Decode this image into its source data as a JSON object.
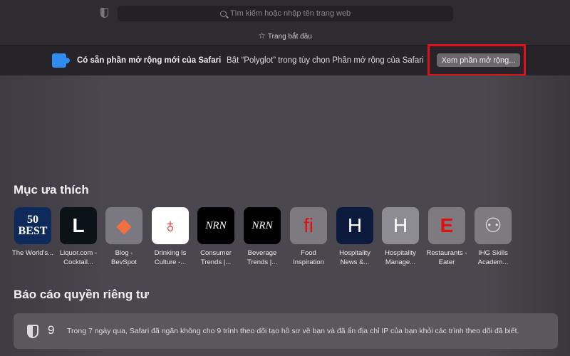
{
  "toolbar": {
    "search_placeholder": "Tìm kiếm hoặc nhập tên trang web",
    "favorites_bar_item": "Trang bắt đầu"
  },
  "banner": {
    "title": "Có sẵn phần mở rộng mới của Safari",
    "message": "Bật “Polyglot” trong tùy chọn Phần mở rộng của Safari",
    "button": "Xem phần mở rộng..."
  },
  "favorites": {
    "heading": "Mục ưa thích",
    "items": [
      {
        "label": "The World's...",
        "glyph": "50\nBEST",
        "bg": "#0e2a5a",
        "fg": "#ffffff"
      },
      {
        "label": "Liquor.com - Cocktail...",
        "glyph": "L",
        "bg": "#0b1218",
        "fg": "#ffffff"
      },
      {
        "label": "Blog - BevSpot",
        "glyph": "◆",
        "bg": "#7a7880",
        "fg": "#f07040"
      },
      {
        "label": "Drinking Is Culture -...",
        "glyph": "♁",
        "bg": "#ffffff",
        "fg": "#d8282e"
      },
      {
        "label": "Consumer Trends |...",
        "glyph": "NRN",
        "bg": "#000000",
        "fg": "#ffffff"
      },
      {
        "label": "Beverage Trends |...",
        "glyph": "NRN",
        "bg": "#000000",
        "fg": "#ffffff"
      },
      {
        "label": "Food Inspiration",
        "glyph": "fi",
        "bg": "#7d7b80",
        "fg": "#e01010"
      },
      {
        "label": "Hospitality News &...",
        "glyph": "H",
        "bg": "#0c1a3e",
        "fg": "#ffffff"
      },
      {
        "label": "Hospitality Manage...",
        "glyph": "H",
        "bg": "#8d8b93",
        "fg": "#ffffff"
      },
      {
        "label": "Restaurants - Eater",
        "glyph": "E",
        "bg": "#7d7b80",
        "fg": "#e01010"
      },
      {
        "label": "IHG Skills Academ...",
        "glyph": "⚇",
        "bg": "#7d7b80",
        "fg": "#e0e0e0"
      }
    ]
  },
  "privacy": {
    "heading": "Báo cáo quyền riêng tư",
    "count": "9",
    "text": "Trong 7 ngày qua, Safari đã ngăn không cho 9 trình theo dõi tạo hồ sơ về bạn và đã ẩn địa chỉ IP của bạn khỏi các trình theo dõi đã biết."
  }
}
